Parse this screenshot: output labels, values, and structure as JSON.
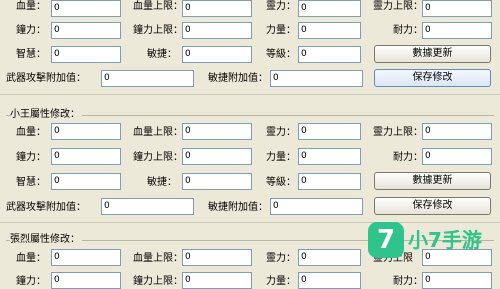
{
  "labels": {
    "hp": "血量：",
    "hp_max": "血量上限：",
    "mp": "靈力：",
    "mp_max": "靈力上限：",
    "mp_max_short": "靈力上限",
    "dmg": "鐘力：",
    "dmg_max": "鐘力上限：",
    "str": "力量：",
    "endure": "耐力：",
    "wis": "智慧：",
    "agi": "敏捷：",
    "lvl": "等級：",
    "weapon": "武器攻擊附加值：",
    "agi_bonus": "敏捷附加值："
  },
  "groups": {
    "g2_title": "小王屬性修改：",
    "g3_title": "張烈屬性修改："
  },
  "values": {
    "zero": "0"
  },
  "buttons": {
    "refresh": "數據更新",
    "save": "保存修改"
  },
  "watermark": {
    "badge": "7",
    "text": "小7手游"
  }
}
